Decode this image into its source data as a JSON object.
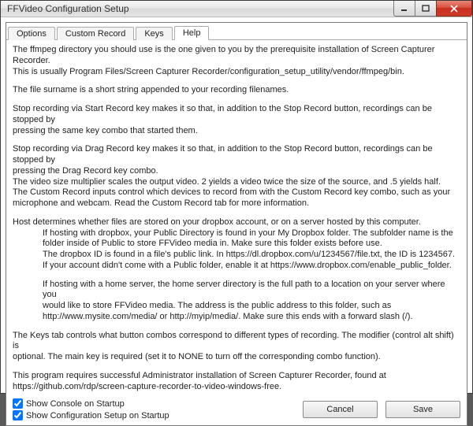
{
  "window": {
    "title": "FFVideo Configuration Setup"
  },
  "tabs": {
    "options": "Options",
    "custom_record": "Custom Record",
    "keys": "Keys",
    "help": "Help"
  },
  "help": {
    "p1a": "The ffmpeg directory you should use is the one given to you by the prerequisite installation of Screen Capturer Recorder.",
    "p1b": "This is usually Program Files/Screen Capturer Recorder/configuration_setup_utility/vendor/ffmpeg/bin.",
    "p2": "The file surname is a short string appended to your recording filenames.",
    "p3a": "Stop recording via Start Record key makes it so that, in addition to the Stop Record button, recordings can be stopped by",
    "p3b": "pressing the same key combo that started them.",
    "p4a": "Stop recording via Drag Record key makes it so that, in addition to the Stop Record button, recordings can be stopped by",
    "p4b": "pressing the Drag Record key combo.",
    "p5": "The video size multiplier scales the output video. 2 yields a video twice the size of the source, and .5 yields half.",
    "p6a": "The Custom Record inputs control which devices to record from with the Custom Record key combo, such as your",
    "p6b": "microphone and webcam. Read the Custom Record tab for more information.",
    "p7": "Host determines whether files are stored on your dropbox account, or on a server hosted by this computer.",
    "p7i1a": "If hosting with dropbox, your Public Directory is found in your My Dropbox folder. The subfolder name is the",
    "p7i1b": "folder inside of Public to store FFVideo media in. Make sure this folder exists before use.",
    "p7i2": "The dropbox ID is found in a file's public link. In https://dl.dropbox.com/u/1234567/file.txt, the ID is 1234567.",
    "p7i3": "If your account didn't come with a Public folder, enable it at https://www.dropbox.com/enable_public_folder.",
    "p7i4a": "If hosting with a home server, the home server directory is the full path to a location on your server where you",
    "p7i4b": "would like to store FFVideo media. The address is the public address to this folder, such as",
    "p7i4c": "http://www.mysite.com/media/ or http://myip/media/. Make sure this ends with a forward slash (/).",
    "p8a": "The Keys tab controls what button combos correspond to different types of recording. The modifier (control alt shift) is",
    "p8b": "optional. The main key is required (set it to NONE to turn off the corresponding combo function).",
    "p9a": "This program requires successful Administrator installation of Screen Capturer Recorder, found at",
    "p9b": "https://github.com/rdp/screen-capture-recorder-to-video-windows-free."
  },
  "bottom": {
    "show_console": "Show Console on Startup",
    "show_config": "Show Configuration Setup on Startup",
    "cancel": "Cancel",
    "save": "Save"
  }
}
